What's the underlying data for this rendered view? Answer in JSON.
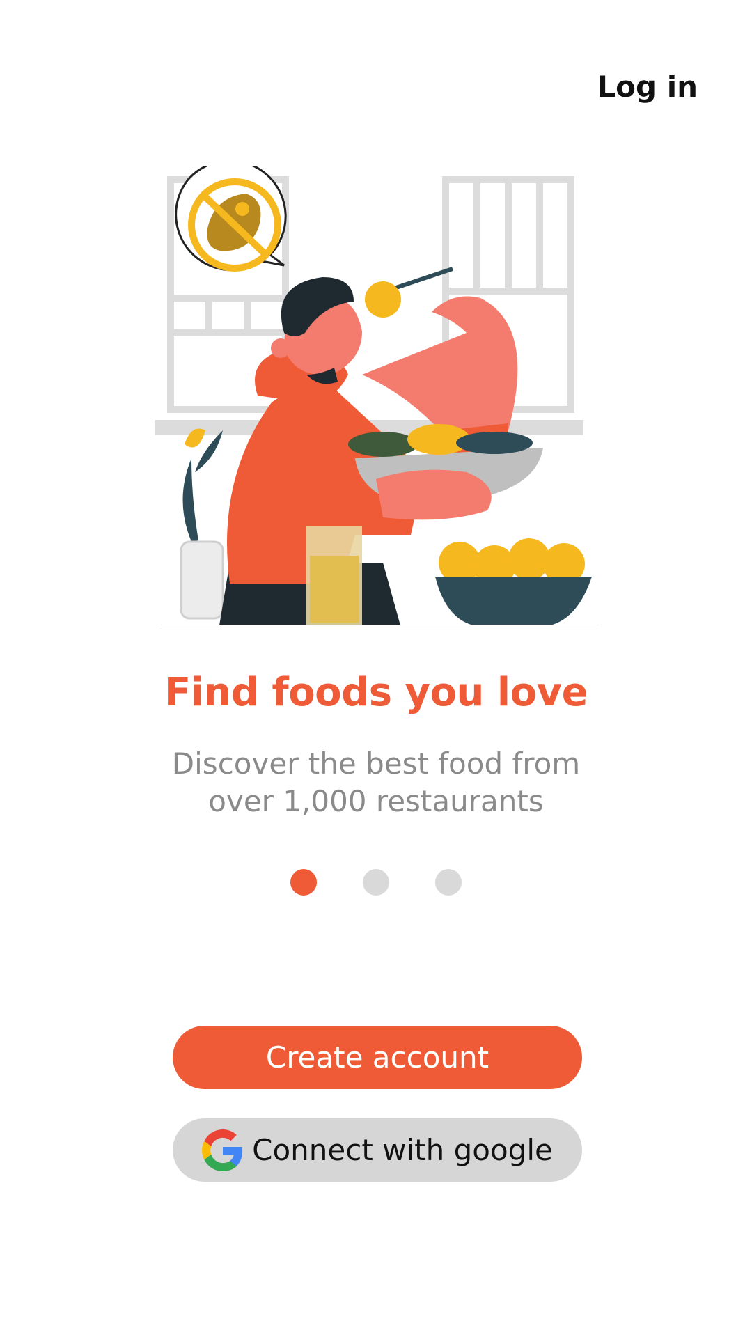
{
  "header": {
    "login_label": "Log in"
  },
  "onboarding": {
    "title": "Find foods you love",
    "subtitle_line1": "Discover the best food from",
    "subtitle_line2": "over 1,000 restaurants",
    "pagination": {
      "total_pages": 3,
      "active_page": 1
    }
  },
  "actions": {
    "create_account_label": "Create account",
    "google_label": "Connect with google"
  },
  "colors": {
    "accent": "#ef5b36",
    "dot_inactive": "#d9d9d9",
    "google_button_bg": "#d6d6d6",
    "subtitle": "#8a8a8a"
  },
  "icons": [
    "google-icon",
    "no-meat-icon"
  ]
}
